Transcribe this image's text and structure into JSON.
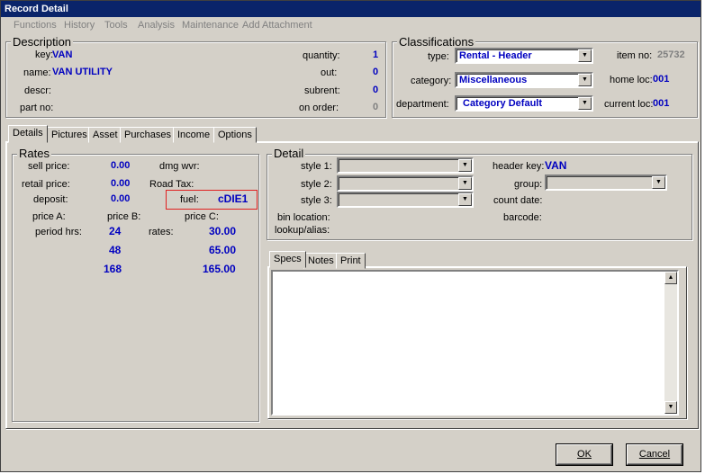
{
  "window": {
    "title": "Record Detail"
  },
  "menu": [
    "Functions",
    "History",
    "Tools",
    "Analysis",
    "Maintenance",
    "Add Attachment"
  ],
  "description": {
    "title": "Description",
    "key_label": "key:",
    "key_value": "VAN",
    "name_label": "name:",
    "name_value": "VAN UTILITY",
    "descr_label": "descr:",
    "partno_label": "part no:",
    "quantity_label": "quantity:",
    "quantity_value": "1",
    "out_label": "out:",
    "out_value": "0",
    "subrent_label": "subrent:",
    "subrent_value": "0",
    "onorder_label": "on order:",
    "onorder_value": "0"
  },
  "classifications": {
    "title": "Classifications",
    "type_label": "type:",
    "type_value": "Rental - Header",
    "category_label": "category:",
    "category_value": "Miscellaneous",
    "department_label": "department:",
    "department_value": "Category Default",
    "itemno_label": "item no:",
    "itemno_value": "25732",
    "homeloc_label": "home loc:",
    "homeloc_value": "001",
    "currentloc_label": "current loc:",
    "currentloc_value": "001"
  },
  "tabs": [
    "Details",
    "Pictures",
    "Asset",
    "Purchases",
    "Income",
    "Options"
  ],
  "rates": {
    "title": "Rates",
    "sell_label": "sell price:",
    "sell_value": "0.00",
    "retail_label": "retail price:",
    "retail_value": "0.00",
    "deposit_label": "deposit:",
    "deposit_value": "0.00",
    "dmg_label": "dmg wvr:",
    "roadtax_label": "Road Tax:",
    "fuel_label": "fuel:",
    "fuel_value": "cDIE1",
    "priceA_label": "price A:",
    "priceB_label": "price B:",
    "priceC_label": "price C:",
    "period_label": "period hrs:",
    "rates_label": "rates:",
    "periods": [
      "24",
      "48",
      "168"
    ],
    "rate_values": [
      "30.00",
      "65.00",
      "165.00"
    ]
  },
  "detail": {
    "title": "Detail",
    "style1_label": "style 1:",
    "style2_label": "style 2:",
    "style3_label": "style 3:",
    "bin_label": "bin location:",
    "lookup_label": "lookup/alias:",
    "headerkey_label": "header key:",
    "headerkey_value": "VAN",
    "group_label": "group:",
    "countdate_label": "count date:",
    "barcode_label": "barcode:"
  },
  "subtabs": [
    "Specs",
    "Notes",
    "Print"
  ],
  "buttons": {
    "ok_label": "OK",
    "cancel_label": "Cancel"
  },
  "icons": {
    "dropdown": "chevron-down-icon",
    "scroll_up": "scroll-up-arrow-icon",
    "scroll_down": "scroll-down-arrow-icon"
  }
}
